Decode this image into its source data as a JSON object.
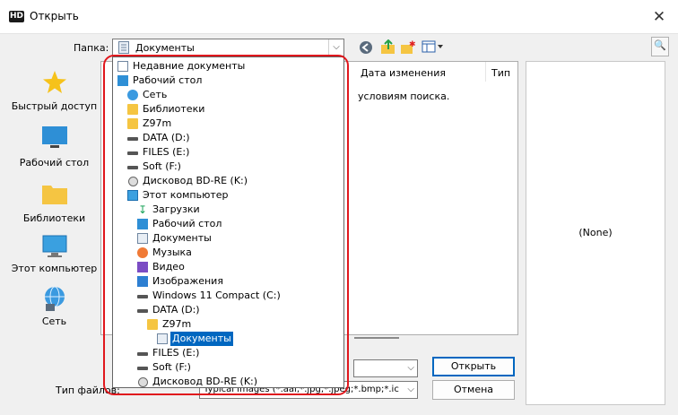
{
  "window": {
    "title": "Открыть",
    "app_icon_text": "HD",
    "close_glyph": "✕"
  },
  "toolbar": {
    "folder_label": "Папка:",
    "current_folder": "Документы"
  },
  "places": [
    {
      "label": "Быстрый доступ",
      "icon": "star-icon"
    },
    {
      "label": "Рабочий стол",
      "icon": "desktop-icon"
    },
    {
      "label": "Библиотеки",
      "icon": "libraries-folder-icon"
    },
    {
      "label": "Этот компьютер",
      "icon": "computer-icon"
    },
    {
      "label": "Сеть",
      "icon": "network-icon"
    }
  ],
  "filelist": {
    "columns": [
      "Дата изменения",
      "Тип"
    ],
    "empty_message": "условиям поиска."
  },
  "form": {
    "filetype_label": "Тип файлов:",
    "filetype_value": "Typical images (*.aai;*.jpg;*.jpeg;*.bmp;*.ico;*.e",
    "open_button": "Открыть",
    "cancel_button": "Отмена"
  },
  "preview": {
    "text": "(None)"
  },
  "dropdown": [
    {
      "label": "Недавние документы",
      "icon": "recent-icon"
    },
    {
      "label": "Рабочий стол",
      "icon": "desktop-icon"
    },
    {
      "label": "Сеть",
      "icon": "network-icon"
    },
    {
      "label": "Библиотеки",
      "icon": "folder-icon"
    },
    {
      "label": "Z97m",
      "icon": "folder-icon"
    },
    {
      "label": "DATA (D:)",
      "icon": "drive-icon"
    },
    {
      "label": "FILES (E:)",
      "icon": "drive-icon"
    },
    {
      "label": "Soft (F:)",
      "icon": "drive-icon"
    },
    {
      "label": "Дисковод BD-RE (K:)",
      "icon": "disc-drive-icon"
    },
    {
      "label": "Этот компьютер",
      "icon": "computer-icon"
    },
    {
      "label": "Загрузки",
      "icon": "download-icon"
    },
    {
      "label": "Рабочий стол",
      "icon": "desktop-icon"
    },
    {
      "label": "Документы",
      "icon": "document-icon"
    },
    {
      "label": "Музыка",
      "icon": "music-icon"
    },
    {
      "label": "Видео",
      "icon": "video-icon"
    },
    {
      "label": "Изображения",
      "icon": "image-icon"
    },
    {
      "label": "Windows 11 Compact (C:)",
      "icon": "drive-icon"
    },
    {
      "label": "DATA (D:)",
      "icon": "drive-icon"
    },
    {
      "label": "Z97m",
      "icon": "folder-icon"
    },
    {
      "label": "Документы",
      "icon": "document-icon",
      "selected": true
    },
    {
      "label": "FILES (E:)",
      "icon": "drive-icon"
    },
    {
      "label": "Soft (F:)",
      "icon": "drive-icon"
    },
    {
      "label": "Дисковод BD-RE (K:)",
      "icon": "disc-drive-icon"
    }
  ]
}
